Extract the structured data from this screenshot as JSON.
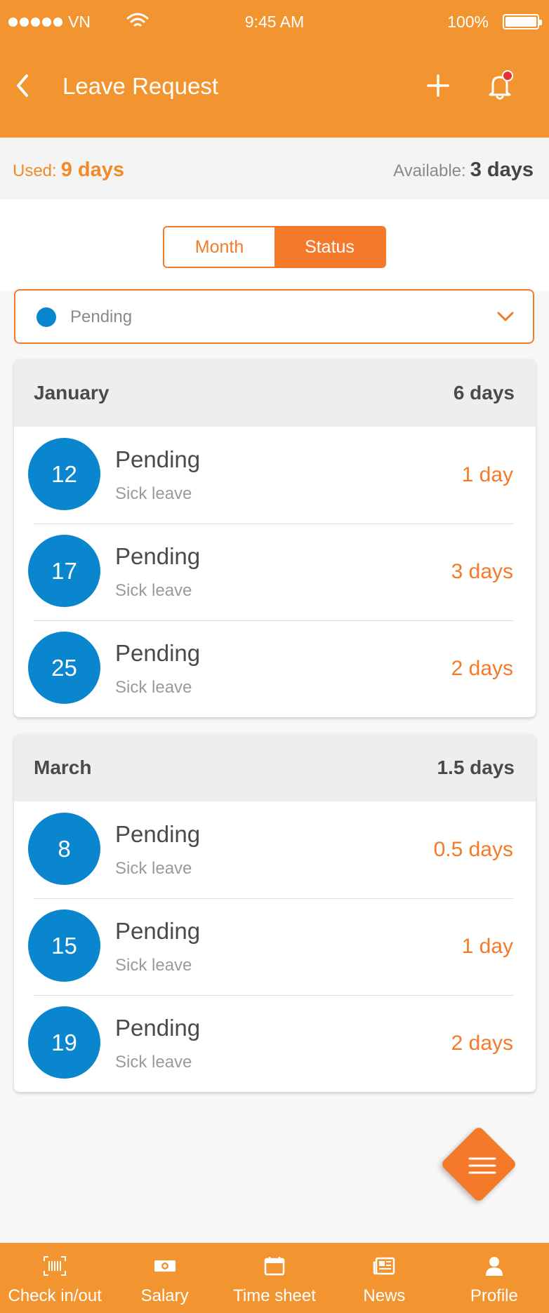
{
  "status_bar": {
    "carrier": "VN",
    "time": "9:45 AM",
    "battery": "100%"
  },
  "header": {
    "title": "Leave Request"
  },
  "usage": {
    "used_label": "Used:",
    "used_value": "9 days",
    "available_label": "Available:",
    "available_value": "3 days"
  },
  "segment": {
    "month_label": "Month",
    "status_label": "Status",
    "selected": "Status"
  },
  "filter": {
    "value": "Pending",
    "dot_color": "#0a86cf"
  },
  "groups": [
    {
      "month": "January",
      "total": "6 days",
      "items": [
        {
          "day": "12",
          "status": "Pending",
          "type": "Sick leave",
          "days": "1 day"
        },
        {
          "day": "17",
          "status": "Pending",
          "type": "Sick leave",
          "days": "3 days"
        },
        {
          "day": "25",
          "status": "Pending",
          "type": "Sick leave",
          "days": "2 days"
        }
      ]
    },
    {
      "month": "March",
      "total": "1.5 days",
      "items": [
        {
          "day": "8",
          "status": "Pending",
          "type": "Sick leave",
          "days": "0.5 days"
        },
        {
          "day": "15",
          "status": "Pending",
          "type": "Sick leave",
          "days": "1 day"
        },
        {
          "day": "19",
          "status": "Pending",
          "type": "Sick leave",
          "days": "2 days"
        }
      ]
    }
  ],
  "tabbar": [
    {
      "label": "Check in/out",
      "icon": "barcode-icon"
    },
    {
      "label": "Salary",
      "icon": "money-icon"
    },
    {
      "label": "Time sheet",
      "icon": "calendar-icon"
    },
    {
      "label": "News",
      "icon": "newspaper-icon"
    },
    {
      "label": "Profile",
      "icon": "user-icon"
    }
  ],
  "colors": {
    "brand": "#f29530",
    "accent": "#f47a2a",
    "status_pending": "#0a86cf",
    "notification": "#e83232"
  }
}
